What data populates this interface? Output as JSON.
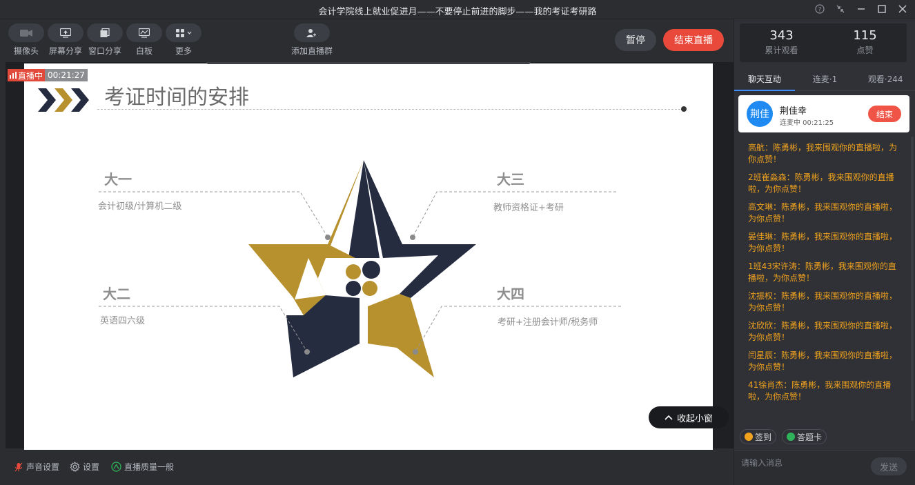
{
  "window": {
    "title": "会计学院线上就业促进月——不要停止前进的脚步——我的考证考研路"
  },
  "toolbar": {
    "camera": "摄像头",
    "screen_share": "屏幕分享",
    "window_share": "窗口分享",
    "whiteboard": "白板",
    "more": "更多",
    "add_group": "添加直播群",
    "pause": "暂停",
    "end_live": "结束直播"
  },
  "live_status": {
    "label": "直播中",
    "elapsed": "00:21:27"
  },
  "slide": {
    "title": "考证时间的安排",
    "year1": {
      "title": "大一",
      "desc": "会计初级/计算机二级"
    },
    "year2": {
      "title": "大二",
      "desc": "英语四六级"
    },
    "year3": {
      "title": "大三",
      "desc": "教师资格证+考研"
    },
    "year4": {
      "title": "大四",
      "desc": "考研+注册会计师/税务师"
    },
    "colors": {
      "gold": "#b8912f",
      "navy": "#262c40"
    }
  },
  "collapse_window": "收起小窗",
  "bottom": {
    "audio": "声音设置",
    "settings": "设置",
    "quality": "直播质量一般"
  },
  "stats": {
    "views": "343",
    "views_label": "累计观看",
    "likes": "115",
    "likes_label": "点赞"
  },
  "tabs": [
    {
      "label": "聊天互动"
    },
    {
      "label": "连麦·1"
    },
    {
      "label": "观看·244"
    }
  ],
  "mic_user": {
    "avatar": "荆佳",
    "name": "荆佳幸",
    "status": "连麦中 00:21:25",
    "end": "结束"
  },
  "messages": [
    "高航：陈勇彬，我来围观你的直播啦，为你点赞！",
    "2班崔淼森：陈勇彬，我来围观你的直播啦，为你点赞！",
    "高文琳：陈勇彬，我来围观你的直播啦，为你点赞！",
    "晏佳琳：陈勇彬，我来围观你的直播啦，为你点赞！",
    "1班43宋许涛：陈勇彬，我来围观你的直播啦，为你点赞！",
    "沈振权：陈勇彬，我来围观你的直播啦，为你点赞！",
    "沈欣欣：陈勇彬，我来围观你的直播啦，为你点赞！",
    "闫星辰：陈勇彬，我来围观你的直播啦，为你点赞！",
    "41徐肖杰：陈勇彬，我来围观你的直播啦，为你点赞！"
  ],
  "chips": {
    "checkin": "签到",
    "answer_card": "答题卡"
  },
  "input": {
    "placeholder": "请输入消息",
    "send": "发送"
  }
}
